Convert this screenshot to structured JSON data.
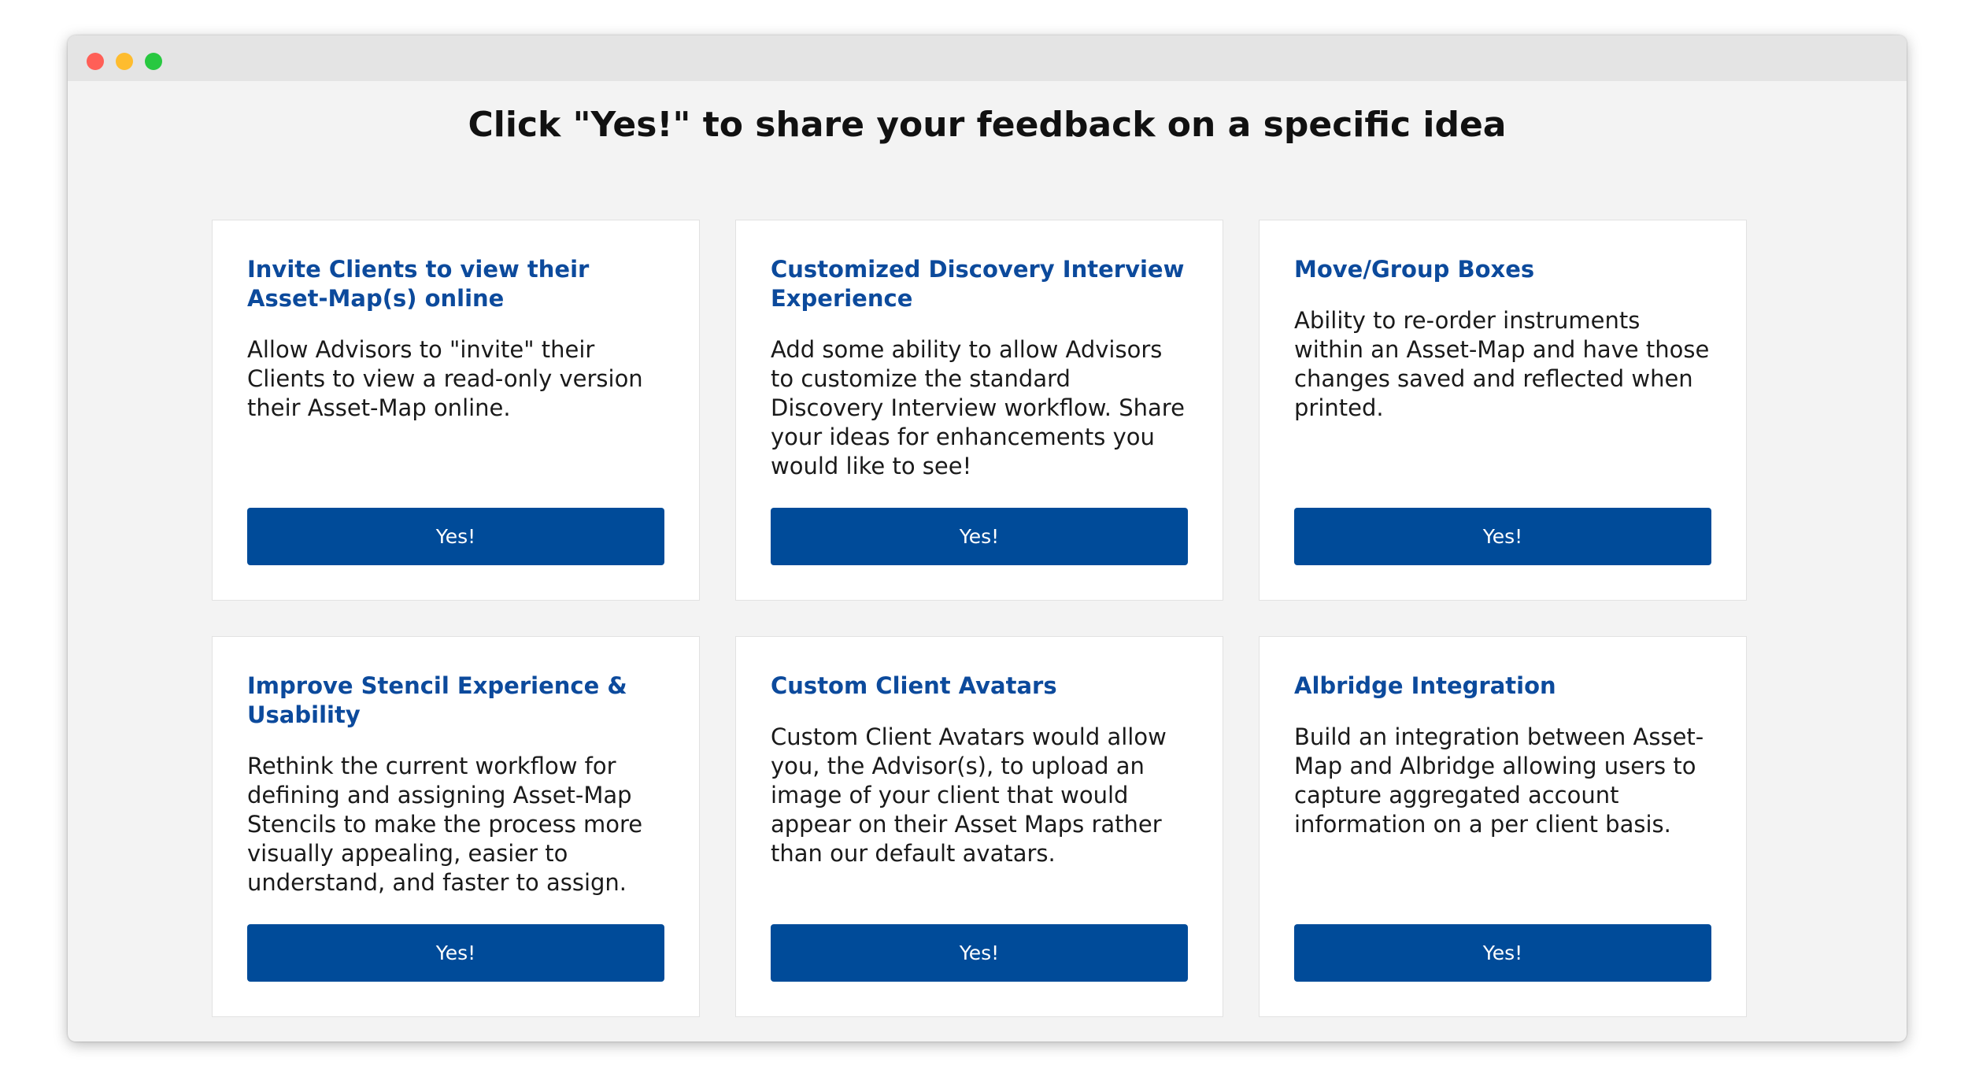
{
  "colors": {
    "accent": "#004b99",
    "title_text": "#0c4a9c",
    "close_dot": "#ff5f57",
    "minimize_dot": "#febc2e",
    "zoom_dot": "#28c840"
  },
  "window": {
    "controls": [
      "close-dot",
      "minimize-dot",
      "zoom-dot"
    ]
  },
  "page": {
    "heading": "Click \"Yes!\" to share your feedback on a specific idea"
  },
  "cards": [
    {
      "title": "Invite Clients to view their Asset-Map(s) online",
      "body": "Allow Advisors to \"invite\" their Clients to view a read-only version their Asset-Map online.",
      "button": "Yes!"
    },
    {
      "title": "Customized Discovery Interview Experience",
      "body": "Add some ability to allow Advisors to customize the standard Discovery Interview workflow.  Share your ideas for enhancements you would like to see!",
      "button": "Yes!"
    },
    {
      "title": "Move/Group Boxes",
      "body": "Ability to re-order instruments within an Asset-Map and have those changes saved and reflected when printed.",
      "button": "Yes!"
    },
    {
      "title": "Improve Stencil Experience & Usability",
      "body": "Rethink the current workflow for defining and assigning Asset-Map Stencils to make the process more visually appealing, easier to understand, and faster to assign.",
      "button": "Yes!"
    },
    {
      "title": "Custom Client Avatars",
      "body": "Custom Client Avatars  would allow you, the Advisor(s), to upload an image of your client that would appear on their Asset Maps rather than our default avatars.",
      "button": "Yes!"
    },
    {
      "title": "Albridge Integration",
      "body": "Build an integration between Asset-Map and Albridge allowing users to capture aggregated account information on a per client basis.",
      "button": "Yes!"
    }
  ]
}
